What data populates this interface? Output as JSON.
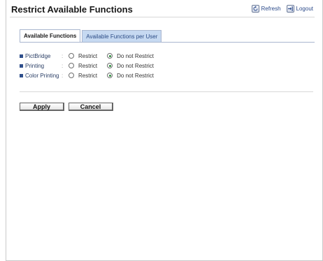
{
  "page": {
    "title": "Restrict Available Functions"
  },
  "toplinks": {
    "refresh_label": "Refresh",
    "logout_label": "Logout"
  },
  "tabs": [
    {
      "label": "Available Functions",
      "active": true
    },
    {
      "label": "Available Functions per User",
      "active": false
    }
  ],
  "separator": ":",
  "settings": [
    {
      "label": "PictBridge",
      "restrict_label": "Restrict",
      "no_restrict_label": "Do not Restrict",
      "selected": "Do not Restrict"
    },
    {
      "label": "Printing",
      "restrict_label": "Restrict",
      "no_restrict_label": "Do not Restrict",
      "selected": "Do not Restrict"
    },
    {
      "label": "Color Printing",
      "restrict_label": "Restrict",
      "no_restrict_label": "Do not Restrict",
      "selected": "Do not Restrict"
    }
  ],
  "buttons": {
    "apply_label": "Apply",
    "cancel_label": "Cancel"
  },
  "colors": {
    "accent": "#2f4f8c",
    "tab_inactive_bg": "#c6d9f1",
    "radio_checked": "#2a8a3a"
  }
}
